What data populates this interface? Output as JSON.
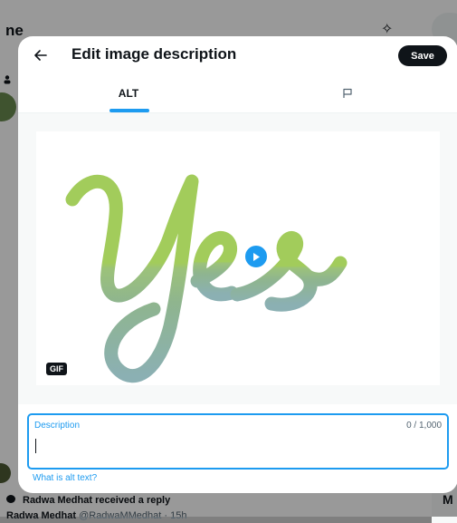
{
  "background": {
    "title_fragment": "ne",
    "notification": "Radwa Medhat received a reply",
    "tweet_author": "Radwa Medhat",
    "tweet_handle": "@RadwaMMedhat · 15h",
    "right_fragment": "M"
  },
  "modal": {
    "title": "Edit image description",
    "save_label": "Save",
    "tabs": [
      {
        "label": "ALT",
        "active": true
      },
      {
        "label": "",
        "icon": "flag-icon",
        "active": false
      }
    ],
    "media": {
      "gif_badge": "GIF",
      "image_text": "Yes",
      "icon": "play-icon"
    },
    "description": {
      "label": "Description",
      "value": "",
      "counter": "0 / 1,000"
    },
    "alt_link": "What is alt text?"
  },
  "colors": {
    "accent": "#1d9bf0",
    "text": "#0f1419",
    "secondary_text": "#536471",
    "media_bg": "#f7f9f9"
  }
}
